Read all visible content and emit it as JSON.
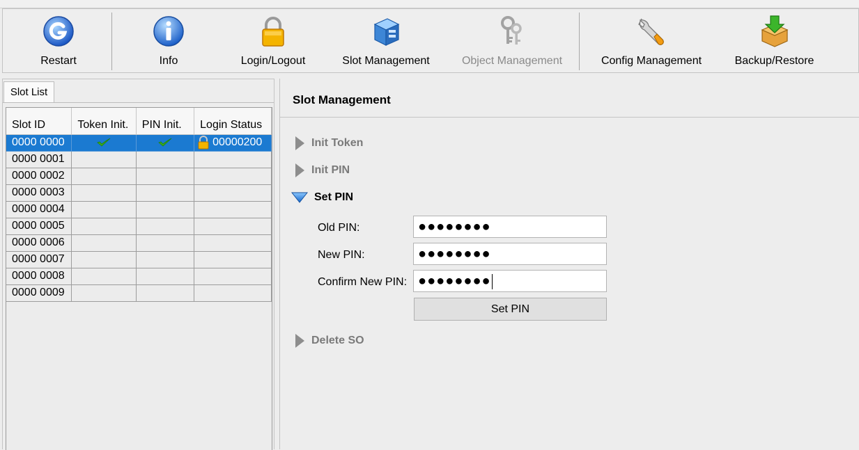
{
  "toolbar": {
    "items": [
      {
        "label": "Restart",
        "icon": "restart-icon",
        "enabled": true
      },
      {
        "label": "Info",
        "icon": "info-icon",
        "enabled": true
      },
      {
        "label": "Login/Logout",
        "icon": "lock-icon",
        "enabled": true
      },
      {
        "label": "Slot Management",
        "icon": "slot-management-icon",
        "enabled": true
      },
      {
        "label": "Object Management",
        "icon": "keys-icon",
        "enabled": false
      },
      {
        "label": "Config Management",
        "icon": "wrench-icon",
        "enabled": true
      },
      {
        "label": "Backup/Restore",
        "icon": "backup-box-icon",
        "enabled": true
      }
    ]
  },
  "slot_list": {
    "tab_label": "Slot List",
    "columns": [
      "Slot ID",
      "Token Init.",
      "PIN Init.",
      "Login Status"
    ],
    "rows": [
      {
        "slot_id": "0000 0000",
        "token_init": true,
        "pin_init": true,
        "login_status": "00000200",
        "locked_icon": true,
        "selected": true
      },
      {
        "slot_id": "0000 0001",
        "token_init": false,
        "pin_init": false,
        "login_status": "",
        "selected": false
      },
      {
        "slot_id": "0000 0002",
        "token_init": false,
        "pin_init": false,
        "login_status": "",
        "selected": false
      },
      {
        "slot_id": "0000 0003",
        "token_init": false,
        "pin_init": false,
        "login_status": "",
        "selected": false
      },
      {
        "slot_id": "0000 0004",
        "token_init": false,
        "pin_init": false,
        "login_status": "",
        "selected": false
      },
      {
        "slot_id": "0000 0005",
        "token_init": false,
        "pin_init": false,
        "login_status": "",
        "selected": false
      },
      {
        "slot_id": "0000 0006",
        "token_init": false,
        "pin_init": false,
        "login_status": "",
        "selected": false
      },
      {
        "slot_id": "0000 0007",
        "token_init": false,
        "pin_init": false,
        "login_status": "",
        "selected": false
      },
      {
        "slot_id": "0000 0008",
        "token_init": false,
        "pin_init": false,
        "login_status": "",
        "selected": false
      },
      {
        "slot_id": "0000 0009",
        "token_init": false,
        "pin_init": false,
        "login_status": "",
        "selected": false
      }
    ]
  },
  "slot_management": {
    "title": "Slot Management",
    "sections": {
      "init_token": "Init Token",
      "init_pin": "Init PIN",
      "set_pin": "Set PIN",
      "delete_so": "Delete SO"
    },
    "form": {
      "old_pin_label": "Old PIN:",
      "old_pin_value": "●●●●●●●●",
      "new_pin_label": "New PIN:",
      "new_pin_value": "●●●●●●●●",
      "confirm_pin_label": "Confirm New PIN:",
      "confirm_pin_value": "●●●●●●●●",
      "submit_label": "Set PIN"
    }
  },
  "colors": {
    "selection": "#1b7ad1",
    "check": "#3cb01c",
    "collapsed_section": "#7a7a7a"
  }
}
